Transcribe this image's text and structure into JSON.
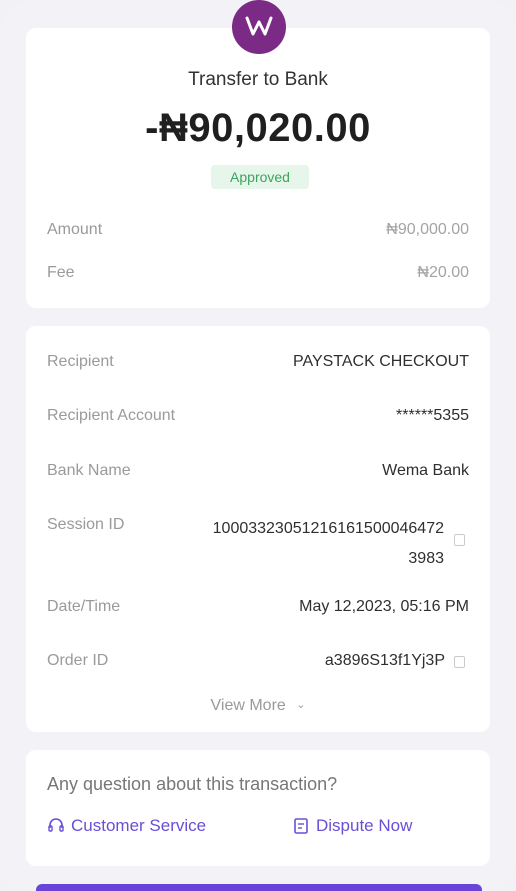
{
  "header": {
    "logo_icon": "wema-logo",
    "title": "Transfer to Bank",
    "amount": "-₦90,020.00",
    "status": "Approved"
  },
  "summary": {
    "amount_label": "Amount",
    "amount_value": "₦90,000.00",
    "fee_label": "Fee",
    "fee_value": "₦20.00"
  },
  "details": {
    "recipient_label": "Recipient",
    "recipient_value": "PAYSTACK CHECKOUT",
    "account_label": "Recipient Account",
    "account_value": "******5355",
    "bank_label": "Bank Name",
    "bank_value": "Wema Bank",
    "session_label": "Session ID",
    "session_value_line1": "1000332305121616150004647​2",
    "session_value_line2": "3983",
    "datetime_label": "Date/Time",
    "datetime_value": "May 12,2023, 05:16 PM",
    "order_label": "Order ID",
    "order_value": "a3896S13f1Yj3P",
    "view_more": "View More"
  },
  "support": {
    "question": "Any question about this transaction?",
    "customer_service": "Customer Service",
    "dispute": "Dispute Now"
  },
  "colors": {
    "brand": "#7b2a86",
    "accent": "#6a4fd6",
    "approved_bg": "#e6f6ea",
    "approved_text": "#3ea35f"
  }
}
